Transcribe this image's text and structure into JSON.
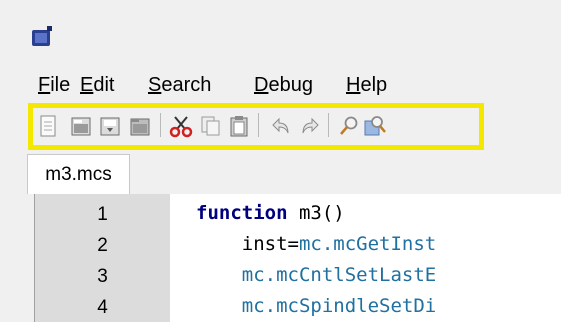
{
  "menu": {
    "file": {
      "m": "F",
      "rest": "ile"
    },
    "edit": {
      "m": "E",
      "rest": "dit"
    },
    "search": {
      "m": "S",
      "rest": "earch"
    },
    "debug": {
      "m": "D",
      "rest": "ebug"
    },
    "help": {
      "m": "H",
      "rest": "elp"
    }
  },
  "toolbar": {
    "icons": [
      "new-file-icon",
      "open-file-icon",
      "save-file-icon",
      "save-all-icon",
      "cut-icon",
      "copy-icon",
      "paste-icon",
      "undo-icon",
      "redo-icon",
      "find-icon",
      "replace-icon"
    ],
    "highlight_color": "#f5e800"
  },
  "tab": {
    "label": "m3.mcs"
  },
  "editor": {
    "lines": [
      {
        "num": "1",
        "keyword": "function",
        "rest": " m3()"
      },
      {
        "num": "2",
        "prefix": "    inst=",
        "call": "mc.mcGetInst"
      },
      {
        "num": "3",
        "prefix": "    ",
        "call": "mc.mcCntlSetLastE"
      },
      {
        "num": "4",
        "prefix": "    ",
        "call": "mc.mcSpindleSetDi"
      }
    ]
  }
}
